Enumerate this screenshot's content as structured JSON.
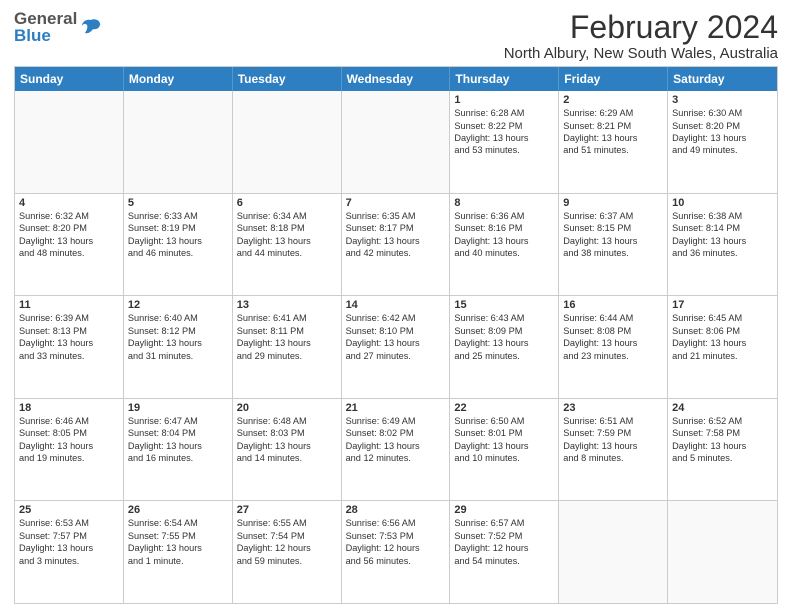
{
  "header": {
    "logo_general": "General",
    "logo_blue": "Blue",
    "title": "February 2024",
    "subtitle": "North Albury, New South Wales, Australia"
  },
  "calendar": {
    "days_of_week": [
      "Sunday",
      "Monday",
      "Tuesday",
      "Wednesday",
      "Thursday",
      "Friday",
      "Saturday"
    ],
    "weeks": [
      [
        {
          "day": "",
          "info": ""
        },
        {
          "day": "",
          "info": ""
        },
        {
          "day": "",
          "info": ""
        },
        {
          "day": "",
          "info": ""
        },
        {
          "day": "1",
          "info": "Sunrise: 6:28 AM\nSunset: 8:22 PM\nDaylight: 13 hours\nand 53 minutes."
        },
        {
          "day": "2",
          "info": "Sunrise: 6:29 AM\nSunset: 8:21 PM\nDaylight: 13 hours\nand 51 minutes."
        },
        {
          "day": "3",
          "info": "Sunrise: 6:30 AM\nSunset: 8:20 PM\nDaylight: 13 hours\nand 49 minutes."
        }
      ],
      [
        {
          "day": "4",
          "info": "Sunrise: 6:32 AM\nSunset: 8:20 PM\nDaylight: 13 hours\nand 48 minutes."
        },
        {
          "day": "5",
          "info": "Sunrise: 6:33 AM\nSunset: 8:19 PM\nDaylight: 13 hours\nand 46 minutes."
        },
        {
          "day": "6",
          "info": "Sunrise: 6:34 AM\nSunset: 8:18 PM\nDaylight: 13 hours\nand 44 minutes."
        },
        {
          "day": "7",
          "info": "Sunrise: 6:35 AM\nSunset: 8:17 PM\nDaylight: 13 hours\nand 42 minutes."
        },
        {
          "day": "8",
          "info": "Sunrise: 6:36 AM\nSunset: 8:16 PM\nDaylight: 13 hours\nand 40 minutes."
        },
        {
          "day": "9",
          "info": "Sunrise: 6:37 AM\nSunset: 8:15 PM\nDaylight: 13 hours\nand 38 minutes."
        },
        {
          "day": "10",
          "info": "Sunrise: 6:38 AM\nSunset: 8:14 PM\nDaylight: 13 hours\nand 36 minutes."
        }
      ],
      [
        {
          "day": "11",
          "info": "Sunrise: 6:39 AM\nSunset: 8:13 PM\nDaylight: 13 hours\nand 33 minutes."
        },
        {
          "day": "12",
          "info": "Sunrise: 6:40 AM\nSunset: 8:12 PM\nDaylight: 13 hours\nand 31 minutes."
        },
        {
          "day": "13",
          "info": "Sunrise: 6:41 AM\nSunset: 8:11 PM\nDaylight: 13 hours\nand 29 minutes."
        },
        {
          "day": "14",
          "info": "Sunrise: 6:42 AM\nSunset: 8:10 PM\nDaylight: 13 hours\nand 27 minutes."
        },
        {
          "day": "15",
          "info": "Sunrise: 6:43 AM\nSunset: 8:09 PM\nDaylight: 13 hours\nand 25 minutes."
        },
        {
          "day": "16",
          "info": "Sunrise: 6:44 AM\nSunset: 8:08 PM\nDaylight: 13 hours\nand 23 minutes."
        },
        {
          "day": "17",
          "info": "Sunrise: 6:45 AM\nSunset: 8:06 PM\nDaylight: 13 hours\nand 21 minutes."
        }
      ],
      [
        {
          "day": "18",
          "info": "Sunrise: 6:46 AM\nSunset: 8:05 PM\nDaylight: 13 hours\nand 19 minutes."
        },
        {
          "day": "19",
          "info": "Sunrise: 6:47 AM\nSunset: 8:04 PM\nDaylight: 13 hours\nand 16 minutes."
        },
        {
          "day": "20",
          "info": "Sunrise: 6:48 AM\nSunset: 8:03 PM\nDaylight: 13 hours\nand 14 minutes."
        },
        {
          "day": "21",
          "info": "Sunrise: 6:49 AM\nSunset: 8:02 PM\nDaylight: 13 hours\nand 12 minutes."
        },
        {
          "day": "22",
          "info": "Sunrise: 6:50 AM\nSunset: 8:01 PM\nDaylight: 13 hours\nand 10 minutes."
        },
        {
          "day": "23",
          "info": "Sunrise: 6:51 AM\nSunset: 7:59 PM\nDaylight: 13 hours\nand 8 minutes."
        },
        {
          "day": "24",
          "info": "Sunrise: 6:52 AM\nSunset: 7:58 PM\nDaylight: 13 hours\nand 5 minutes."
        }
      ],
      [
        {
          "day": "25",
          "info": "Sunrise: 6:53 AM\nSunset: 7:57 PM\nDaylight: 13 hours\nand 3 minutes."
        },
        {
          "day": "26",
          "info": "Sunrise: 6:54 AM\nSunset: 7:55 PM\nDaylight: 13 hours\nand 1 minute."
        },
        {
          "day": "27",
          "info": "Sunrise: 6:55 AM\nSunset: 7:54 PM\nDaylight: 12 hours\nand 59 minutes."
        },
        {
          "day": "28",
          "info": "Sunrise: 6:56 AM\nSunset: 7:53 PM\nDaylight: 12 hours\nand 56 minutes."
        },
        {
          "day": "29",
          "info": "Sunrise: 6:57 AM\nSunset: 7:52 PM\nDaylight: 12 hours\nand 54 minutes."
        },
        {
          "day": "",
          "info": ""
        },
        {
          "day": "",
          "info": ""
        }
      ]
    ]
  }
}
